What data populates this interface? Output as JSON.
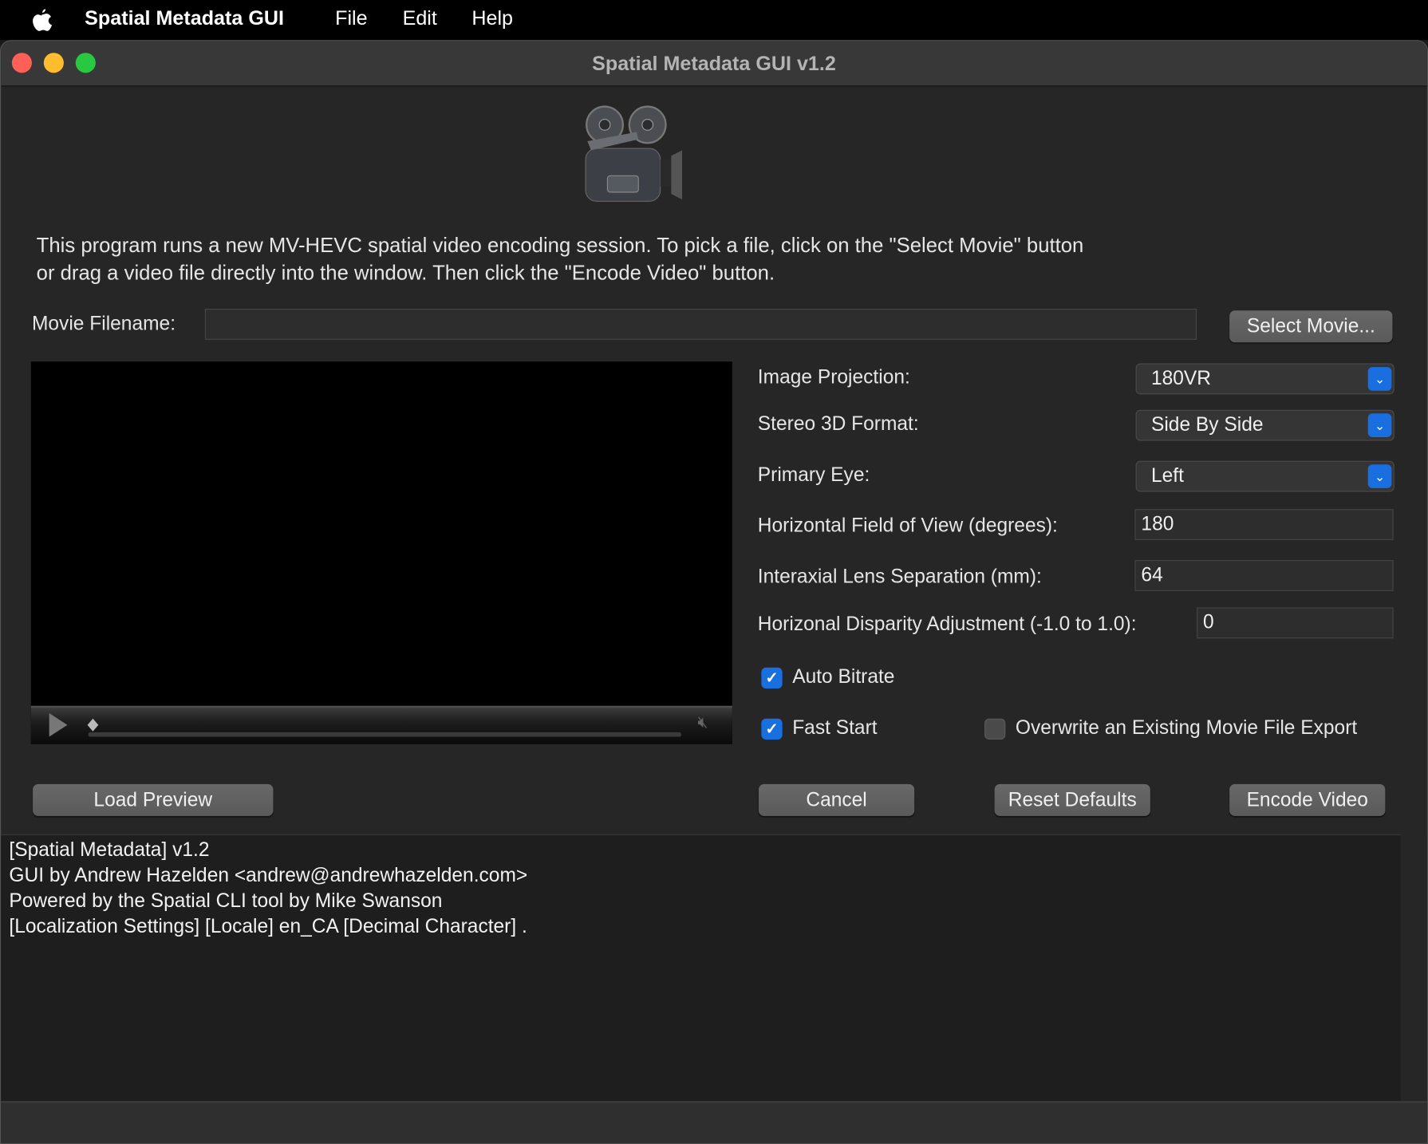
{
  "menubar": {
    "app_name": "Spatial Metadata GUI",
    "items": [
      "File",
      "Edit",
      "Help"
    ]
  },
  "window": {
    "title": "Spatial Metadata GUI v1.2",
    "traffic_lights": {
      "close": "#fe5f57",
      "minimize": "#febc2e",
      "zoom": "#28c840"
    }
  },
  "description": [
    "This program runs a new MV-HEVC spatial video encoding session. To pick a file, click on the \"Select Movie\" button",
    "or drag a video file directly into the window. Then click the \"Encode Video\" button."
  ],
  "movie": {
    "label": "Movie Filename:",
    "value": "",
    "select_button": "Select Movie..."
  },
  "settings": {
    "image_projection": {
      "label": "Image Projection:",
      "value": "180VR"
    },
    "stereo_format": {
      "label": "Stereo 3D Format:",
      "value": "Side By Side"
    },
    "primary_eye": {
      "label": "Primary Eye:",
      "value": "Left"
    },
    "hfov": {
      "label": "Horizontal Field of View (degrees):",
      "value": "180"
    },
    "interaxial": {
      "label": "Interaxial Lens Separation (mm):",
      "value": "64"
    },
    "disparity": {
      "label": "Horizonal Disparity Adjustment (-1.0 to 1.0):",
      "value": "0"
    },
    "auto_bitrate": {
      "label": "Auto Bitrate",
      "checked": true
    },
    "fast_start": {
      "label": "Fast Start",
      "checked": true
    },
    "overwrite": {
      "label": "Overwrite an Existing Movie File Export",
      "checked": false
    }
  },
  "buttons": {
    "load_preview": "Load Preview",
    "cancel": "Cancel",
    "reset": "Reset Defaults",
    "encode": "Encode Video"
  },
  "log": [
    "[Spatial Metadata] v1.2",
    "GUI by Andrew Hazelden <andrew@andrewhazelden.com>",
    "Powered by the Spatial CLI tool by Mike Swanson",
    "[Localization Settings] [Locale] en_CA [Decimal Character] ."
  ],
  "accent_color": "#1a6fe0"
}
